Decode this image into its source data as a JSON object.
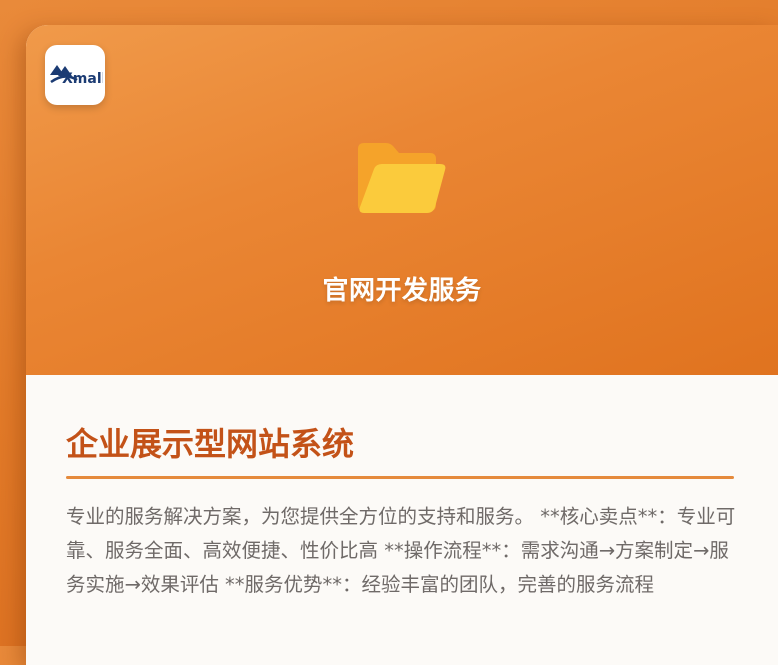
{
  "brand": {
    "logo_text": "Xmall"
  },
  "hero": {
    "title": "官网开发服务",
    "icon": "folder-icon"
  },
  "content": {
    "title": "企业展示型网站系统",
    "description": "专业的服务解决方案，为您提供全方位的支持和服务。 **核心卖点**：专业可靠、服务全面、高效便捷、性价比高 **操作流程**：需求沟通→方案制定→服务实施→效果评估 **服务优势**：经验丰富的团队，完善的服务流程"
  },
  "colors": {
    "background": "#e27a28",
    "hero": "#ea8634",
    "title_accent": "#c35218",
    "divider": "#e58a3c",
    "body_text": "#6f6a68"
  }
}
